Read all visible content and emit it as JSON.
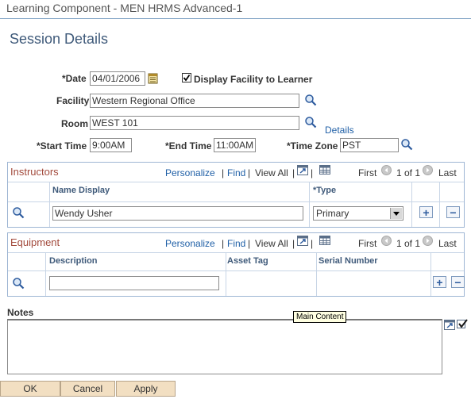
{
  "window": {
    "title": "Learning Component - MEN HRMS Advanced-1"
  },
  "page": {
    "title": "Session Details"
  },
  "form": {
    "date_label": "*Date",
    "date_value": "04/01/2006",
    "display_facility_label": "Display Facility to Learner",
    "display_facility_checked": true,
    "facility_label": "Facility",
    "facility_value": "Western Regional Office",
    "room_label": "Room",
    "room_value": "WEST 101",
    "details_link": "Details",
    "start_time_label": "*Start Time",
    "start_time_value": "9:00AM",
    "end_time_label": "*End Time",
    "end_time_value": "11:00AM",
    "time_zone_label": "*Time Zone",
    "time_zone_value": "PST"
  },
  "instructors": {
    "title": "Instructors",
    "personalize": "Personalize",
    "find": "Find",
    "view_all": "View All",
    "first": "First",
    "range": "1 of 1",
    "last": "Last",
    "columns": {
      "name_display": "Name Display",
      "type": "*Type"
    },
    "rows": [
      {
        "name": "Wendy Usher",
        "type": "Primary"
      }
    ],
    "add_glyph": "+",
    "remove_glyph": "−"
  },
  "equipment": {
    "title": "Equipment",
    "personalize": "Personalize",
    "find": "Find",
    "view_all": "View All",
    "first": "First",
    "range": "1 of 1",
    "last": "Last",
    "columns": {
      "description": "Description",
      "asset_tag": "Asset Tag",
      "serial_number": "Serial Number"
    },
    "rows": [
      {
        "description": "",
        "asset_tag": "",
        "serial_number": ""
      }
    ],
    "add_glyph": "+",
    "remove_glyph": "−"
  },
  "notes": {
    "label": "Notes",
    "value": ""
  },
  "tooltip": {
    "text": "Main Content"
  },
  "buttons": {
    "ok": "OK",
    "cancel": "Cancel",
    "apply": "Apply"
  },
  "separators": {
    "pipe": "|"
  },
  "icons": {
    "lookup": "magnifier-icon",
    "calendar": "calendar-icon",
    "zoom": "zoom-window-icon",
    "download": "grid-download-icon",
    "spellcheck": "spellcheck-icon"
  },
  "colors": {
    "section_title": "#a24a3c",
    "link": "#1f5fa6",
    "page_title": "#3f5a7a",
    "button_bg": "#f2dfc2",
    "section_border": "#9eb6d4"
  }
}
